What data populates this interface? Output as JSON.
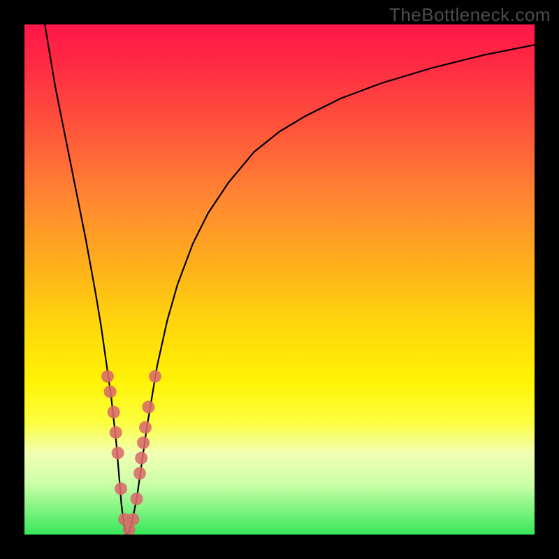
{
  "watermark": "TheBottleneck.com",
  "chart_data": {
    "type": "line",
    "title": "",
    "xlabel": "",
    "ylabel": "",
    "xlim": [
      0,
      100
    ],
    "ylim": [
      0,
      100
    ],
    "grid": false,
    "series": [
      {
        "name": "curve",
        "x": [
          4,
          6,
          8,
          10,
          12,
          14,
          15,
          16,
          17,
          18,
          18.5,
          19,
          19.5,
          20,
          20.5,
          21,
          22,
          23,
          24,
          25,
          26,
          28,
          30,
          33,
          36,
          40,
          45,
          50,
          55,
          62,
          70,
          80,
          90,
          100
        ],
        "y": [
          100,
          88,
          78,
          68,
          58,
          47,
          41,
          34,
          27,
          18,
          12,
          6,
          2,
          0,
          0.5,
          2,
          7,
          14,
          21,
          27,
          33,
          42,
          49,
          57,
          63,
          69,
          75,
          79,
          82,
          85.5,
          88.5,
          91.5,
          94,
          96
        ]
      }
    ],
    "points": {
      "name": "markers",
      "x": [
        16.3,
        16.8,
        17.5,
        17.9,
        18.3,
        18.9,
        19.6,
        20.5,
        21.3,
        22.0,
        22.6,
        22.9,
        23.3,
        23.7,
        24.3,
        25.6
      ],
      "y": [
        31,
        28,
        24,
        20,
        16,
        9,
        3,
        1,
        3,
        7,
        12,
        15,
        18,
        21,
        25,
        31
      ]
    },
    "point_radius_px": 9,
    "colors": {
      "curve": "#000000",
      "markers": "#d96a6a",
      "gradient_top": "#ff1749",
      "gradient_bottom": "#36e85a",
      "frame": "#000000"
    },
    "legend": false
  }
}
